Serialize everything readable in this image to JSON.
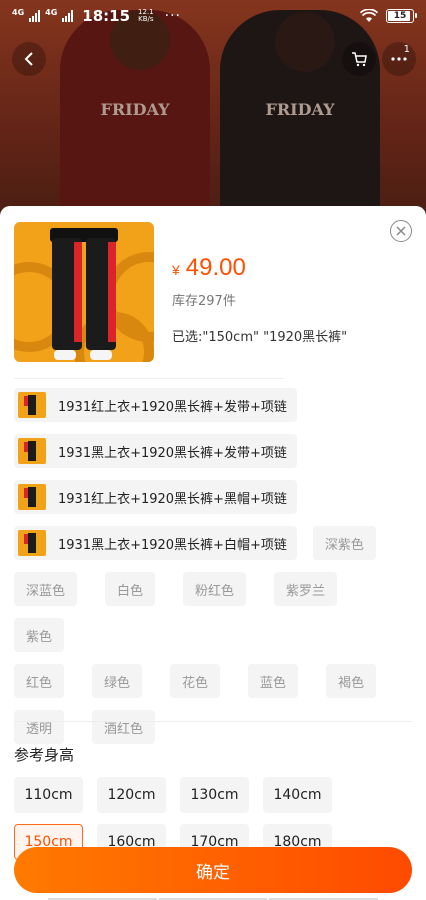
{
  "status_bar": {
    "network_1": "4G",
    "network_2": "4G",
    "time": "18:15",
    "speed_value": "12.1",
    "speed_unit": "KB/s",
    "more": "···",
    "battery": "15"
  },
  "header": {
    "cart_badge": "1"
  },
  "product": {
    "currency": "¥",
    "price": "49.00",
    "stock": "库存297件",
    "selected": "已选:\"150cm\" \"1920黑长裤\""
  },
  "options": {
    "image_chips": [
      "1931红上衣+1920黑长裤+发带+项链",
      "1931黑上衣+1920黑长裤+发带+项链",
      "1931红上衣+1920黑长裤+黑帽+项链",
      "1931黑上衣+1920黑长裤+白帽+项链"
    ],
    "disabled_colors": [
      "深紫色",
      "深蓝色",
      "白色",
      "粉红色",
      "紫罗兰",
      "紫色",
      "红色",
      "绿色",
      "花色",
      "蓝色",
      "褐色",
      "透明",
      "酒红色"
    ]
  },
  "height_section": {
    "title": "参考身高",
    "sizes_row1": [
      "110cm",
      "120cm",
      "130cm",
      "140cm"
    ],
    "sizes_row2": [
      "150cm",
      "160cm",
      "170cm",
      "180cm"
    ],
    "selected": "150cm"
  },
  "confirm_label": "确定",
  "colors": {
    "accent": "#ff5000",
    "button_start": "#ff7a00",
    "button_end": "#ff4a00"
  }
}
